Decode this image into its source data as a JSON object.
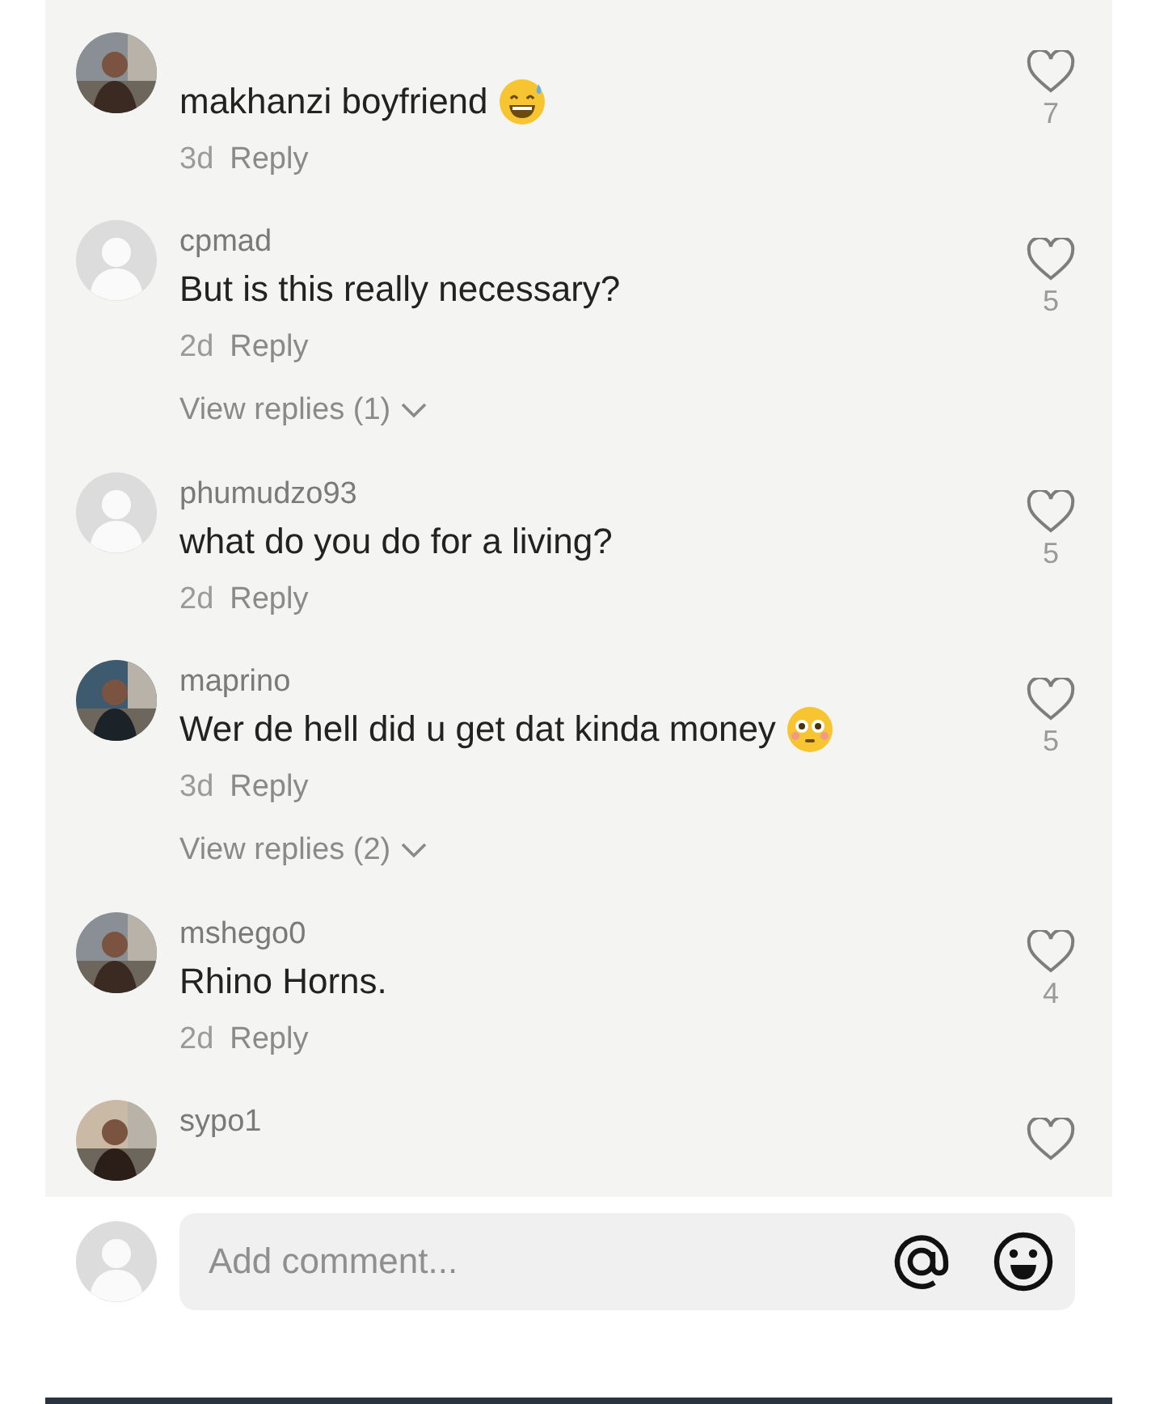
{
  "comments": [
    {
      "text": "makhanzi boyfriend",
      "emoji": {
        "kind": "sweat_smile"
      },
      "age": "3d",
      "reply": "Reply",
      "likes": "7"
    },
    {
      "username": "cpmad",
      "avatar": {
        "kind": "default"
      },
      "text": "But is this really necessary?",
      "age": "2d",
      "reply": "Reply",
      "view_replies": "View replies (1)",
      "likes": "5"
    },
    {
      "username": "phumudzo93",
      "avatar": {
        "kind": "default"
      },
      "text": "what do you do for a living?",
      "age": "2d",
      "reply": "Reply",
      "likes": "5"
    },
    {
      "username": "maprino",
      "text": "Wer de hell did u get dat kinda money",
      "emoji": {
        "kind": "flushed"
      },
      "age": "3d",
      "reply": "Reply",
      "view_replies": "View replies (2)",
      "likes": "5"
    },
    {
      "username": "mshego0",
      "text": "Rhino Horns.",
      "age": "2d",
      "reply": "Reply",
      "likes": "4"
    },
    {
      "username": "sypo1"
    }
  ],
  "composer": {
    "placeholder": "Add comment..."
  }
}
